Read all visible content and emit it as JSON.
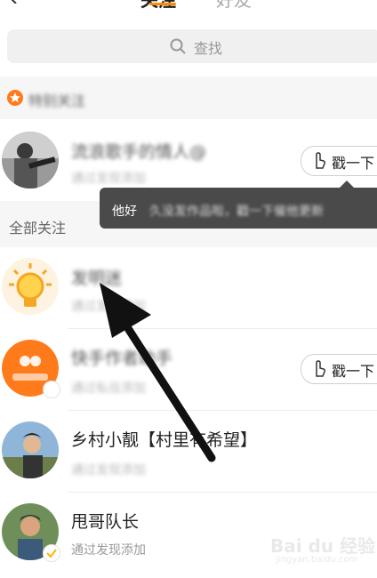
{
  "header": {
    "tab_follow": "关注",
    "tab_friends": "好友"
  },
  "search": {
    "placeholder": "查找"
  },
  "special_section": {
    "label": "特别关注"
  },
  "all_section": {
    "label": "全部关注"
  },
  "tooltip": {
    "prefix": "他好",
    "rest": "久没发作品啦，戳一下催他更新"
  },
  "poke_label": "戳一下",
  "contacts": [
    {
      "name": "流浪歌手的情人@",
      "sub": "通过发现添加"
    },
    {
      "name": "发明迷",
      "sub": "通过发现添加"
    },
    {
      "name": "快手作者助手",
      "sub": "通过私信添加"
    },
    {
      "name": "乡村小靓【村里有希望】",
      "sub": "通过发现添加"
    },
    {
      "name": "甩哥队长",
      "sub": "通过发现添加"
    }
  ],
  "watermark": {
    "line1": "Bai du 经验",
    "line2": "jingyan.baidu.com"
  },
  "colors": {
    "accent": "#ff8a00",
    "tooltip_bg": "#4a4a4a"
  }
}
